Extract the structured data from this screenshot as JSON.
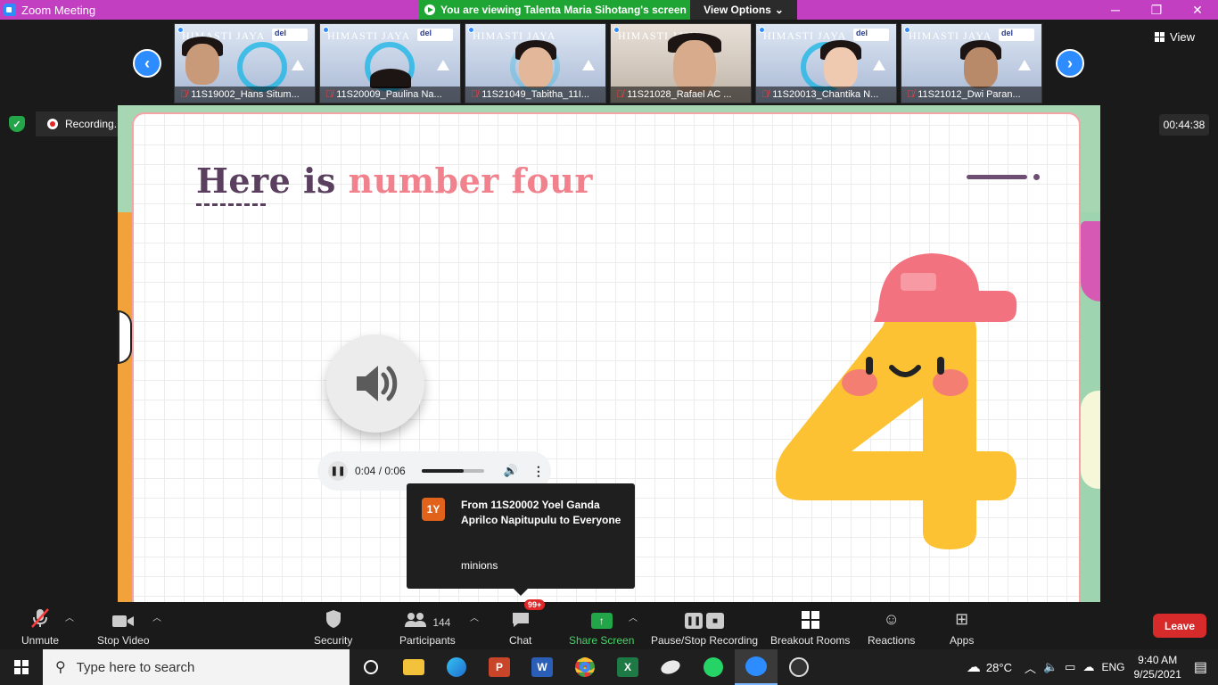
{
  "window": {
    "title": "Zoom Meeting",
    "viewing_banner": "You are viewing Talenta Maria Sihotang's screen",
    "view_options": "View Options"
  },
  "thumbnails": [
    {
      "name": "11S19002_Hans Situm..."
    },
    {
      "name": "11S20009_Paulina Na..."
    },
    {
      "name": "11S21049_Tabitha_11I..."
    },
    {
      "name": "11S21028_Rafael AC ..."
    },
    {
      "name": "11S20013_Chantika N..."
    },
    {
      "name": "11S21012_Dwi Paran..."
    }
  ],
  "thumb_banner": {
    "org": "HIMASTI JAYA",
    "logo": "del"
  },
  "view_label": "View",
  "recording": {
    "label": "Recording...",
    "timer": "00:44:38"
  },
  "slide": {
    "title_a": "Here is ",
    "title_b": "number four",
    "audio_time": "0:04 / 0:06",
    "audio_progress": 0.67
  },
  "chat_popup": {
    "avatar": "1Y",
    "from": "From 11S20002 Yoel Ganda Aprilco Napitupulu to Everyone",
    "message": "minions"
  },
  "toolbar": {
    "unmute": "Unmute",
    "stop_video": "Stop Video",
    "security": "Security",
    "participants": "Participants",
    "participants_count": "144",
    "chat": "Chat",
    "chat_badge": "99+",
    "share_screen": "Share Screen",
    "pause_stop_recording": "Pause/Stop Recording",
    "breakout_rooms": "Breakout Rooms",
    "reactions": "Reactions",
    "apps": "Apps",
    "leave": "Leave"
  },
  "taskbar": {
    "search_placeholder": "Type here to search",
    "temperature": "28°C",
    "language": "ENG",
    "time": "9:40 AM",
    "date": "9/25/2021"
  },
  "colors": {
    "titlebar": "#c23fc2",
    "banner_green": "#1fa534",
    "leave_red": "#d72a2a",
    "zoom_blue": "#2d8cff"
  }
}
